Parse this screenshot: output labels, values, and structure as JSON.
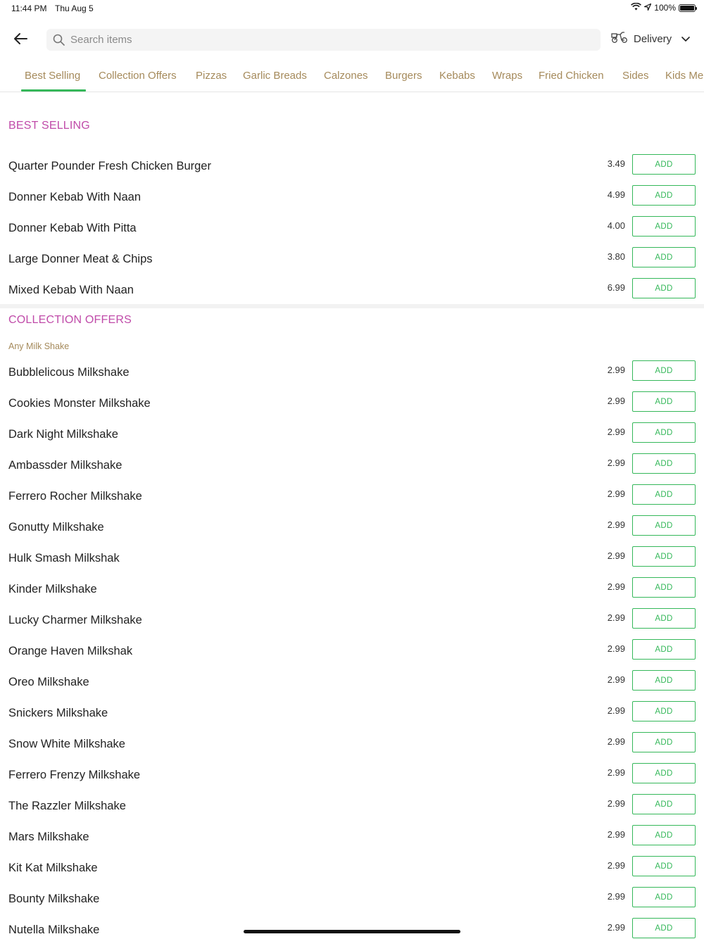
{
  "status_bar": {
    "time": "11:44 PM",
    "date": "Thu Aug 5",
    "battery": "100%"
  },
  "search": {
    "placeholder": "Search items"
  },
  "delivery": {
    "label": "Delivery"
  },
  "tabs": [
    "Best Selling",
    "Collection Offers",
    "Pizzas",
    "Garlic Breads",
    "Calzones",
    "Burgers",
    "Kebabs",
    "Wraps",
    "Fried Chicken",
    "Sides",
    "Kids Me"
  ],
  "active_tab": "Best Selling",
  "colors": {
    "accent_green": "#35b85a",
    "section_title": "#c04ba9",
    "tab_text": "#a58a5b"
  },
  "add_label": "ADD",
  "sections": [
    {
      "title": "BEST SELLING",
      "subtitle": "",
      "items": [
        {
          "name": "Quarter Pounder Fresh Chicken Burger",
          "price": "3.49"
        },
        {
          "name": "Donner Kebab With Naan",
          "price": "4.99"
        },
        {
          "name": "Donner Kebab With Pitta",
          "price": "4.00"
        },
        {
          "name": "Large Donner Meat & Chips",
          "price": "3.80"
        },
        {
          "name": "Mixed Kebab With Naan",
          "price": "6.99"
        }
      ]
    },
    {
      "title": "COLLECTION OFFERS",
      "subtitle": "Any Milk Shake",
      "items": [
        {
          "name": "Bubblelicous Milkshake",
          "price": "2.99"
        },
        {
          "name": "Cookies Monster Milkshake",
          "price": "2.99"
        },
        {
          "name": "Dark Night Milkshake",
          "price": "2.99"
        },
        {
          "name": "Ambassder Milkshake",
          "price": "2.99"
        },
        {
          "name": "Ferrero Rocher Milkshake",
          "price": "2.99"
        },
        {
          "name": "Gonutty Milkshake",
          "price": "2.99"
        },
        {
          "name": "Hulk Smash Milkshak",
          "price": "2.99"
        },
        {
          "name": "Kinder Milkshake",
          "price": "2.99"
        },
        {
          "name": "Lucky Charmer Milkshake",
          "price": "2.99"
        },
        {
          "name": "Orange Haven Milkshak",
          "price": "2.99"
        },
        {
          "name": "Oreo Milkshake",
          "price": "2.99"
        },
        {
          "name": "Snickers Milkshake",
          "price": "2.99"
        },
        {
          "name": "Snow White Milkshake",
          "price": "2.99"
        },
        {
          "name": "Ferrero Frenzy Milkshake",
          "price": "2.99"
        },
        {
          "name": "The Razzler Milkshake",
          "price": "2.99"
        },
        {
          "name": "Mars Milkshake",
          "price": "2.99"
        },
        {
          "name": "Kit Kat Milkshake",
          "price": "2.99"
        },
        {
          "name": "Bounty Milkshake",
          "price": "2.99"
        },
        {
          "name": "Nutella Milkshake",
          "price": "2.99"
        }
      ]
    }
  ]
}
